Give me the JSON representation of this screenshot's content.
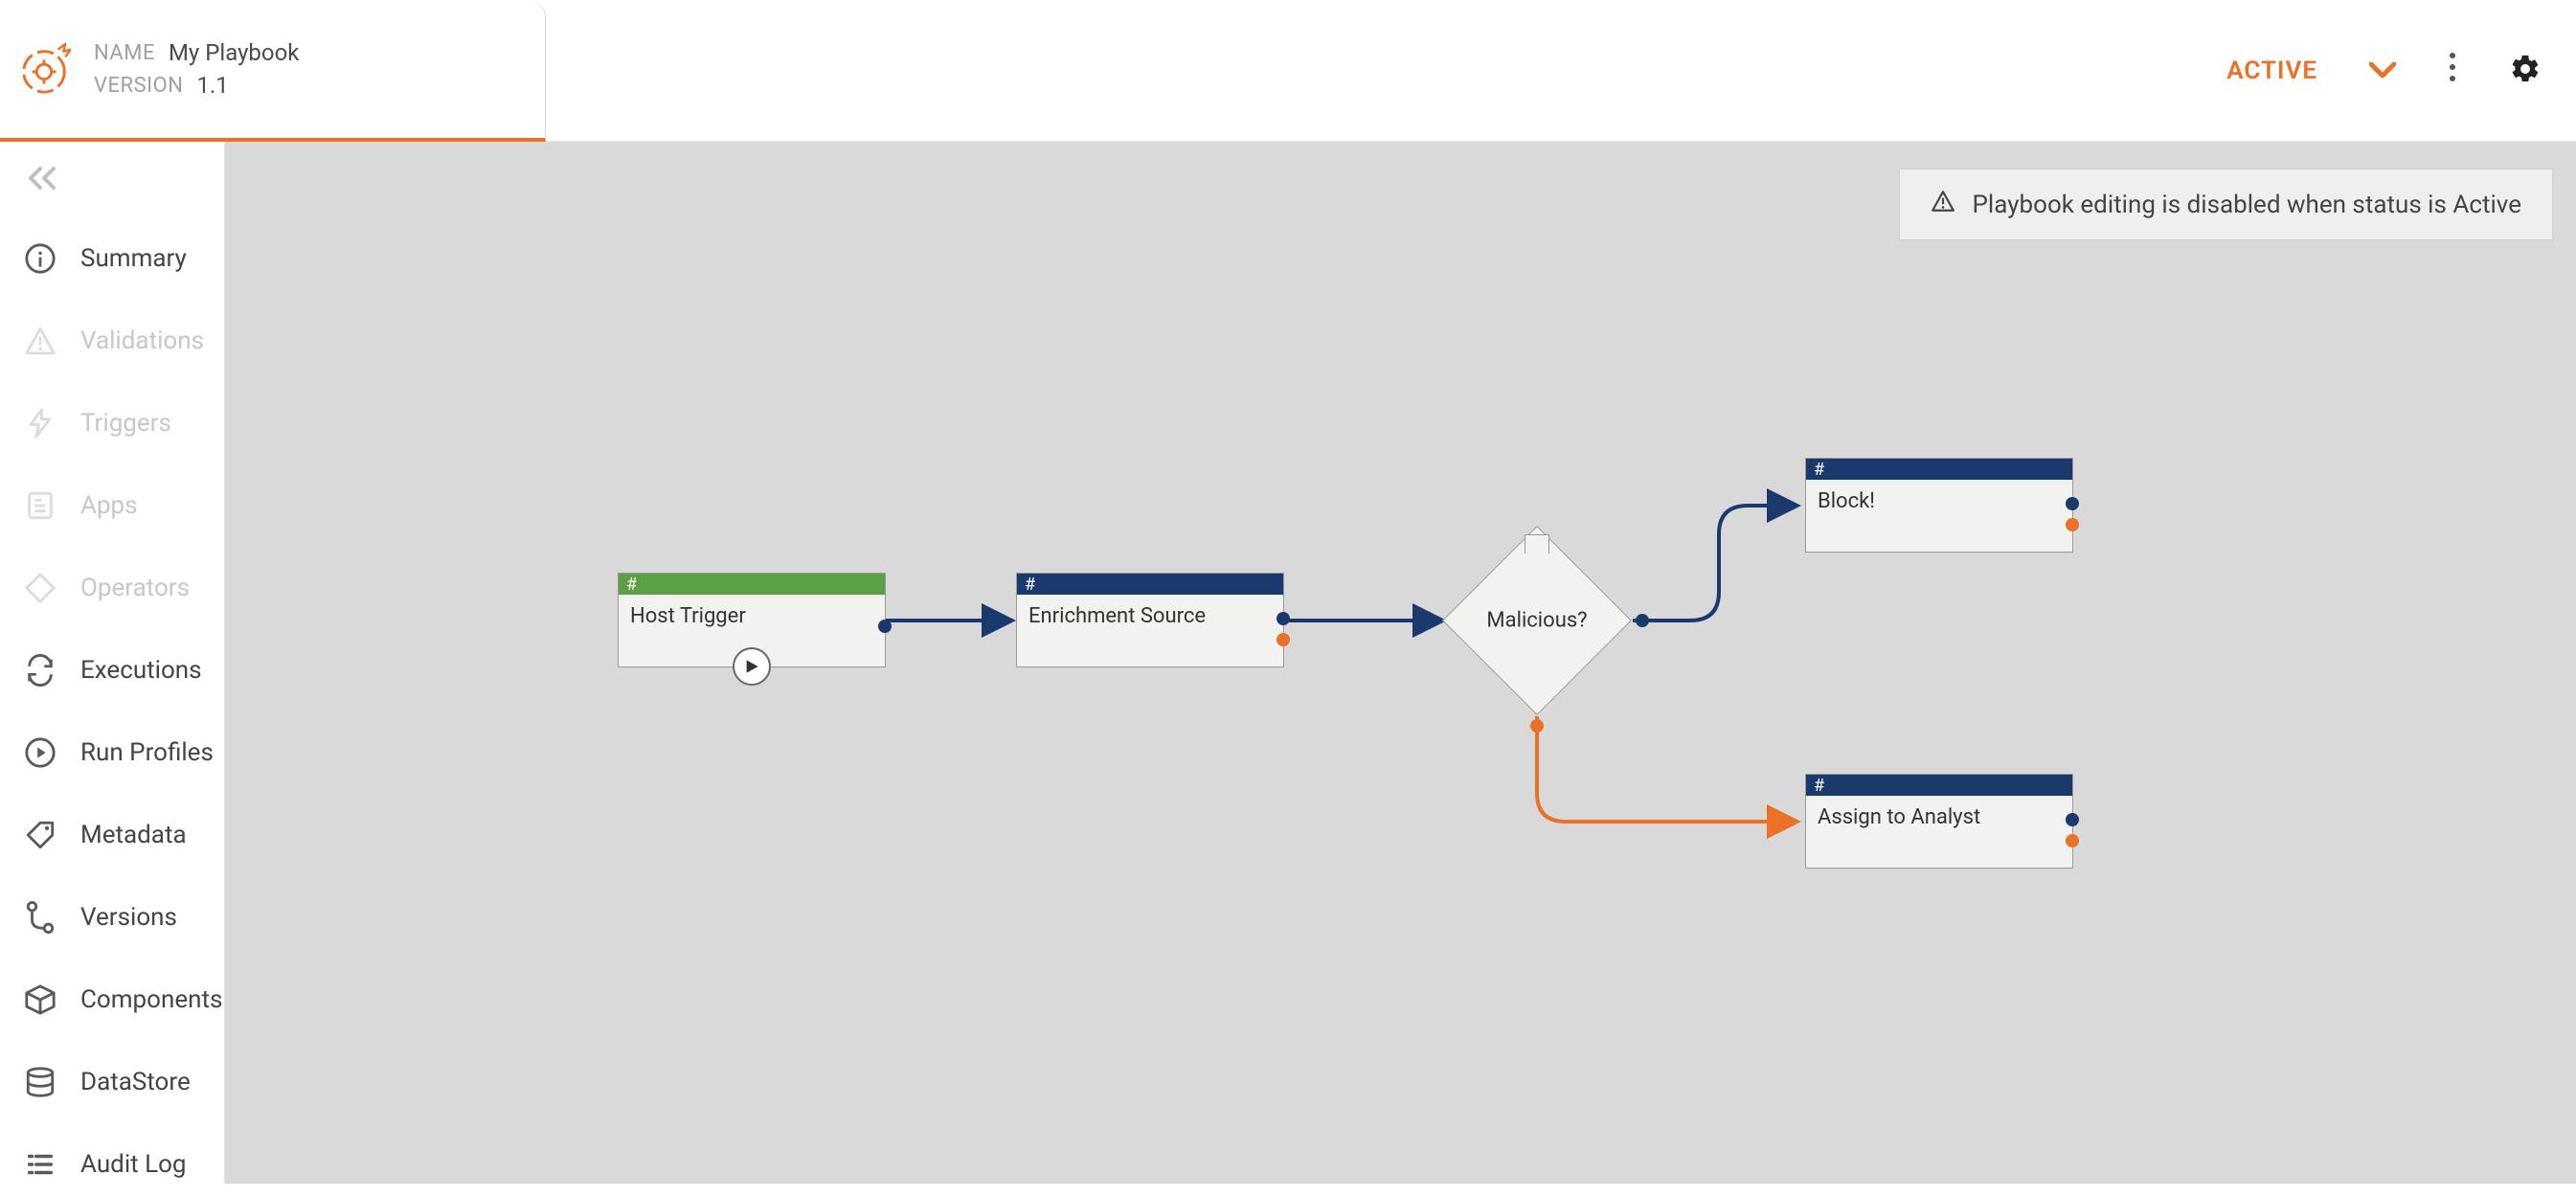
{
  "header": {
    "name_label": "NAME",
    "name_value": "My Playbook",
    "version_label": "VERSION",
    "version_value": "1.1",
    "status": "ACTIVE"
  },
  "sidebar": {
    "collapse": "«",
    "items": [
      {
        "id": "summary",
        "label": "Summary",
        "disabled": false
      },
      {
        "id": "validations",
        "label": "Validations",
        "disabled": true
      },
      {
        "id": "triggers",
        "label": "Triggers",
        "disabled": true
      },
      {
        "id": "apps",
        "label": "Apps",
        "disabled": true
      },
      {
        "id": "operators",
        "label": "Operators",
        "disabled": true
      },
      {
        "id": "executions",
        "label": "Executions",
        "disabled": false
      },
      {
        "id": "runprofiles",
        "label": "Run Profiles",
        "disabled": false
      },
      {
        "id": "metadata",
        "label": "Metadata",
        "disabled": false
      },
      {
        "id": "versions",
        "label": "Versions",
        "disabled": false
      },
      {
        "id": "components",
        "label": "Components",
        "disabled": false
      },
      {
        "id": "datastore",
        "label": "DataStore",
        "disabled": false
      },
      {
        "id": "auditlog",
        "label": "Audit Log",
        "disabled": false
      }
    ]
  },
  "canvas": {
    "banner": "Playbook editing is disabled when status is Active",
    "nodes": {
      "trigger": {
        "title": "Host Trigger",
        "hash": "#"
      },
      "enrich": {
        "title": "Enrichment Source",
        "hash": "#"
      },
      "decision": {
        "title": "Malicious?"
      },
      "block": {
        "title": "Block!",
        "hash": "#"
      },
      "assign": {
        "title": "Assign to Analyst",
        "hash": "#"
      }
    }
  },
  "colors": {
    "accent_orange": "#ea7125",
    "accent_green": "#5ba045",
    "accent_blue": "#1a3a6e"
  }
}
